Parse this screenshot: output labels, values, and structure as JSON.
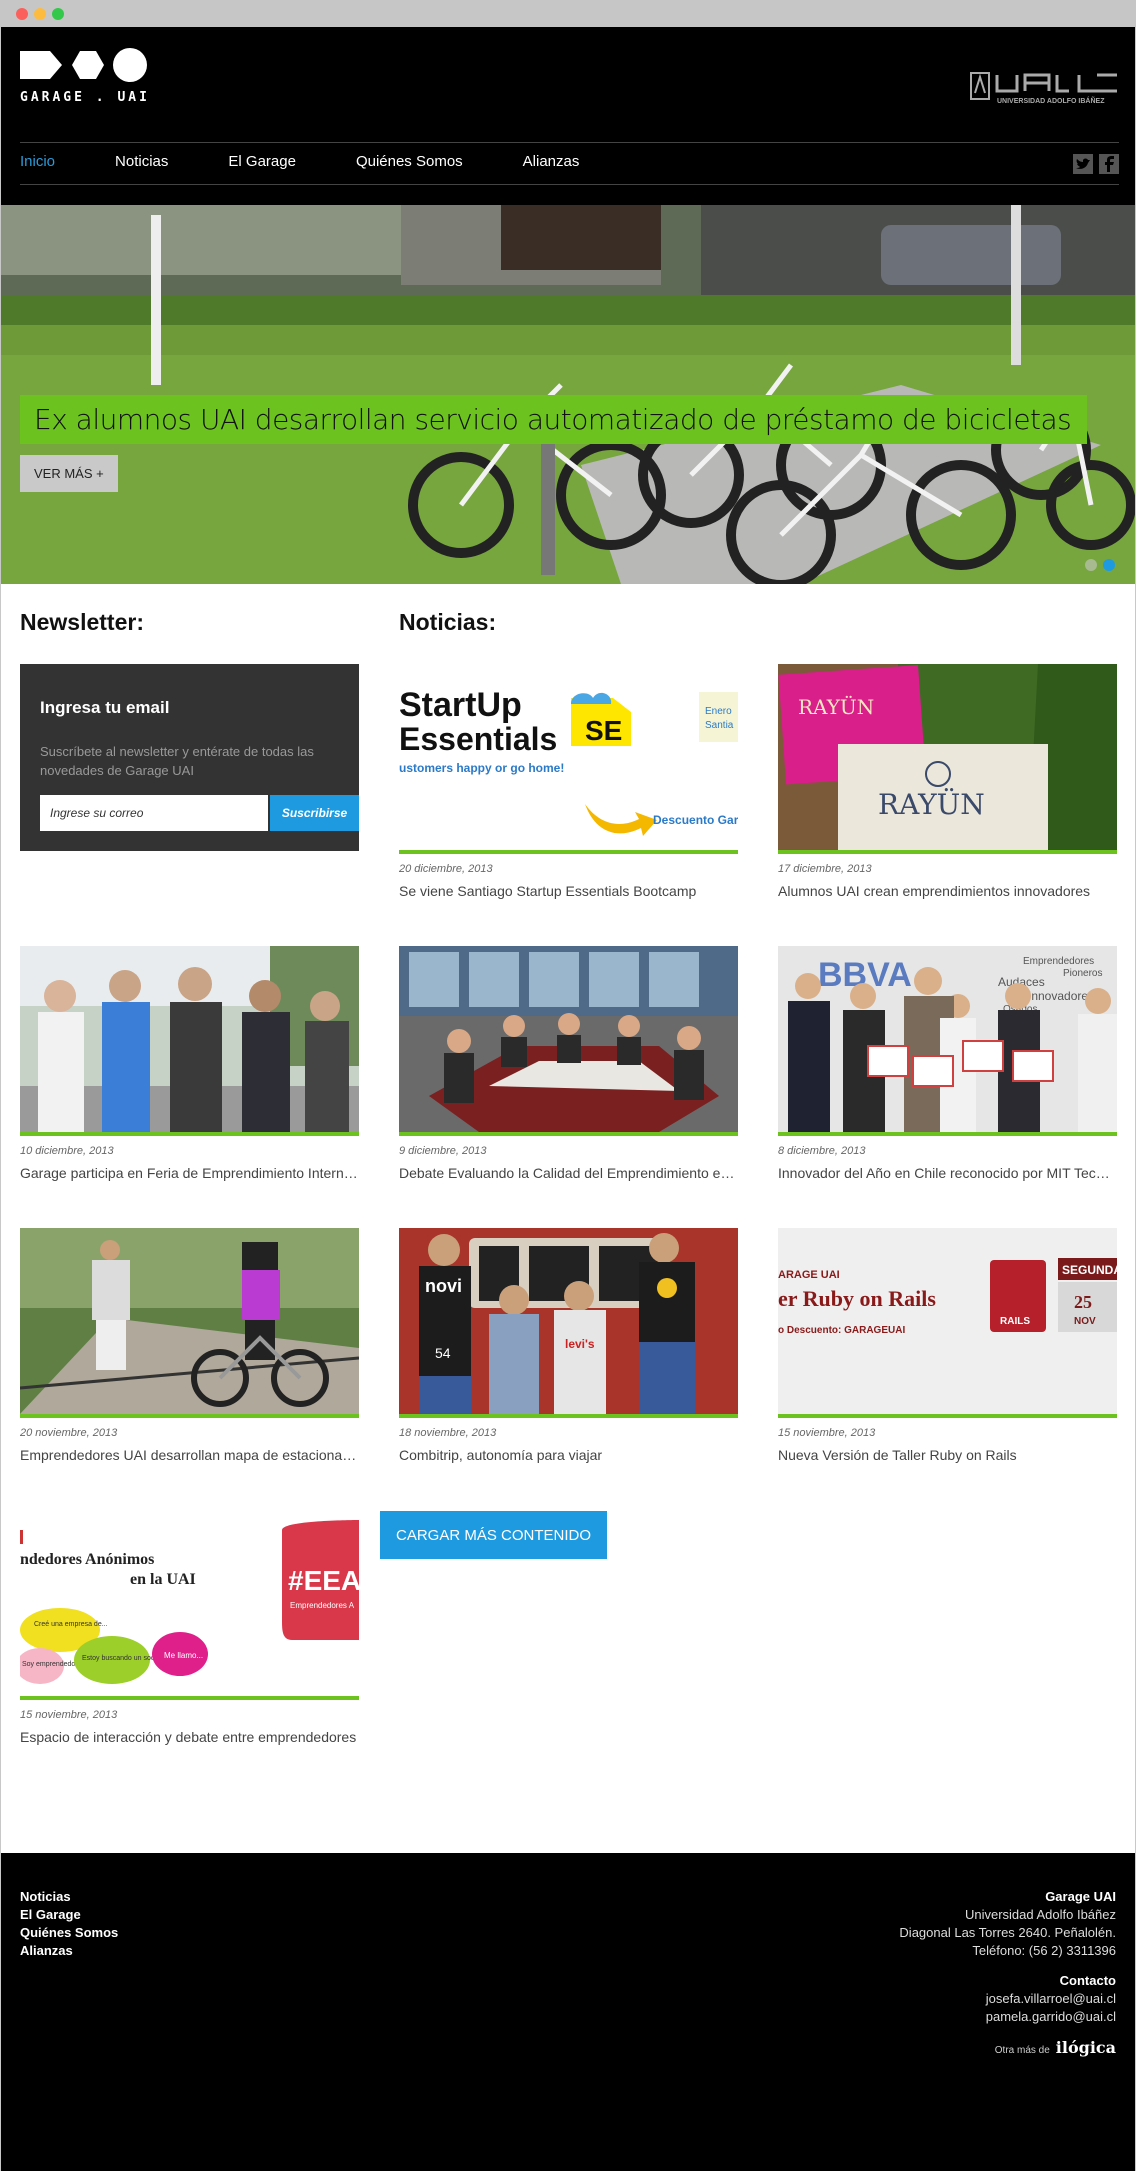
{
  "header": {
    "logo_text": "GARAGE . UAI",
    "uai_logo_text": "UNIVERSIDAD ADOLFO IBÁÑEZ",
    "nav": [
      {
        "label": "Inicio",
        "active": true
      },
      {
        "label": "Noticias"
      },
      {
        "label": "El Garage"
      },
      {
        "label": "Quiénes Somos"
      },
      {
        "label": "Alianzas"
      }
    ],
    "social": [
      "twitter-icon",
      "facebook-icon"
    ]
  },
  "hero": {
    "caption": "Ex alumnos UAI desarrollan servicio automatizado de préstamo de bicicletas",
    "button": "VER MÁS +",
    "slides": 2,
    "active_slide": 2
  },
  "newsletter": {
    "section_title": "Newsletter:",
    "title": "Ingresa tu email",
    "text": "Suscríbete al newsletter y entérate de todas las novedades de Garage UAI",
    "input_placeholder": "Ingrese su correo",
    "button": "Suscribirse"
  },
  "news": {
    "section_title": "Noticias:",
    "items": [
      {
        "date": "20 diciembre, 2013",
        "title": "Se viene Santiago Startup Essentials Bootcamp",
        "img_text": [
          "StartUp",
          "Essentials",
          "ustomers happy or go home!",
          "SE",
          "Enero",
          "Santia",
          "Descuento Gar"
        ]
      },
      {
        "date": "17 diciembre, 2013",
        "title": "Alumnos UAI crean emprendimientos innovadores",
        "img_text": [
          "RAYÜN",
          "RAYÜN"
        ]
      },
      {
        "date": "10 diciembre, 2013",
        "title": "Garage participa en Feria de Emprendimiento Internacional"
      },
      {
        "date": "9 diciembre, 2013",
        "title": "Debate Evaluando la Calidad del Emprendimiento en Chile"
      },
      {
        "date": "8 diciembre, 2013",
        "title": "Innovador del Año en Chile reconocido por MIT Technology Review",
        "img_text": [
          "BBVA",
          "Emprendedores",
          "Audaces",
          "Pioneros",
          "Innovadores",
          "Osados"
        ]
      },
      {
        "date": "20 noviembre, 2013",
        "title": "Emprendedores UAI desarrollan mapa de estacionamientos"
      },
      {
        "date": "18 noviembre, 2013",
        "title": "Combitrip, autonomía para viajar",
        "img_text": [
          "novi",
          "54",
          "levi's"
        ]
      },
      {
        "date": "15 noviembre, 2013",
        "title": "Nueva Versión de Taller Ruby on Rails",
        "img_text": [
          "ARAGE UAI",
          "er Ruby on Rails",
          "o Descuento: GARAGEUAI",
          "RAILS",
          "SEGUNDA",
          "25",
          "NOV"
        ]
      },
      {
        "date": "15 noviembre, 2013",
        "title": "Espacio de interacción y debate entre emprendedores",
        "img_text": [
          "ndedores Anónimos",
          "en la UAI",
          "#EEA",
          "Emprendedores A",
          "Creé una empresa de...",
          "Soy emprendedor...",
          "Estoy buscando un socio...",
          "Me llamo..."
        ]
      }
    ],
    "load_more": "CARGAR MÁS CONTENIDO"
  },
  "footer": {
    "links": [
      "Noticias",
      "El Garage",
      "Quiénes Somos",
      "Alianzas"
    ],
    "org_title": "Garage UAI",
    "org_lines": [
      "Universidad Adolfo Ibáñez",
      "Diagonal Las Torres 2640. Peñalolén.",
      "Teléfono: (56 2) 3311396"
    ],
    "contact_title": "Contacto",
    "contacts": [
      "josefa.villarroel@uai.cl",
      "pamela.garrido@uai.cl"
    ],
    "credit_prefix": "Otra más de",
    "credit_brand": "ilógica"
  },
  "colors": {
    "accent_blue": "#1e9be0",
    "accent_green": "#6cc21f",
    "header_bg": "#000000",
    "newsletter_bg": "#333333"
  }
}
